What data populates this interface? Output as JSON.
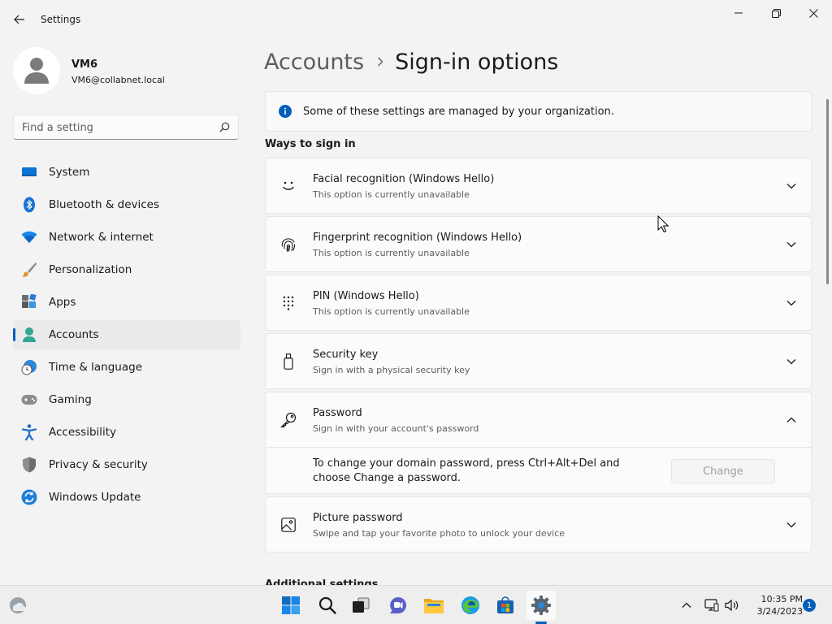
{
  "app": {
    "title": "Settings"
  },
  "user": {
    "name": "VM6",
    "email": "VM6@collabnet.local"
  },
  "search": {
    "placeholder": "Find a setting"
  },
  "nav": {
    "items": [
      {
        "label": "System",
        "icon": "system-icon",
        "active": false
      },
      {
        "label": "Bluetooth & devices",
        "icon": "bluetooth-icon",
        "active": false
      },
      {
        "label": "Network & internet",
        "icon": "wifi-icon",
        "active": false
      },
      {
        "label": "Personalization",
        "icon": "brush-icon",
        "active": false
      },
      {
        "label": "Apps",
        "icon": "apps-icon",
        "active": false
      },
      {
        "label": "Accounts",
        "icon": "accounts-icon",
        "active": true
      },
      {
        "label": "Time & language",
        "icon": "globe-clock-icon",
        "active": false
      },
      {
        "label": "Gaming",
        "icon": "gamepad-icon",
        "active": false
      },
      {
        "label": "Accessibility",
        "icon": "accessibility-icon",
        "active": false
      },
      {
        "label": "Privacy & security",
        "icon": "shield-icon",
        "active": false
      },
      {
        "label": "Windows Update",
        "icon": "update-icon",
        "active": false
      }
    ]
  },
  "breadcrumb": {
    "parent": "Accounts",
    "current": "Sign-in options"
  },
  "info": {
    "text": "Some of these settings are managed by your organization."
  },
  "section": {
    "title": "Ways to sign in",
    "next_title": "Additional settings"
  },
  "options": [
    {
      "title": "Facial recognition (Windows Hello)",
      "subtitle": "This option is currently unavailable",
      "icon": "face-icon",
      "expanded": false
    },
    {
      "title": "Fingerprint recognition (Windows Hello)",
      "subtitle": "This option is currently unavailable",
      "icon": "fingerprint-icon",
      "expanded": false
    },
    {
      "title": "PIN (Windows Hello)",
      "subtitle": "This option is currently unavailable",
      "icon": "pin-keypad-icon",
      "expanded": false
    },
    {
      "title": "Security key",
      "subtitle": "Sign in with a physical security key",
      "icon": "usb-key-icon",
      "expanded": false
    },
    {
      "title": "Password",
      "subtitle": "Sign in with your account's password",
      "icon": "key-icon",
      "expanded": true,
      "body_text": "To change your domain password, press Ctrl+Alt+Del and choose Change a password.",
      "button_label": "Change",
      "button_enabled": false
    },
    {
      "title": "Picture password",
      "subtitle": "Swipe and tap your favorite photo to unlock your device",
      "icon": "picture-icon",
      "expanded": false
    }
  ],
  "taskbar": {
    "apps": [
      "start-icon",
      "search-icon",
      "task-view-icon",
      "chat-icon",
      "file-explorer-icon",
      "edge-icon",
      "store-icon",
      "settings-icon"
    ],
    "active_app": "settings-icon",
    "clock_time": "10:35 PM",
    "clock_date": "3/24/2023",
    "notification_count": "1"
  },
  "colors": {
    "accent": "#005fb8",
    "background": "#f3f3f3",
    "card": "#fbfbfb"
  }
}
